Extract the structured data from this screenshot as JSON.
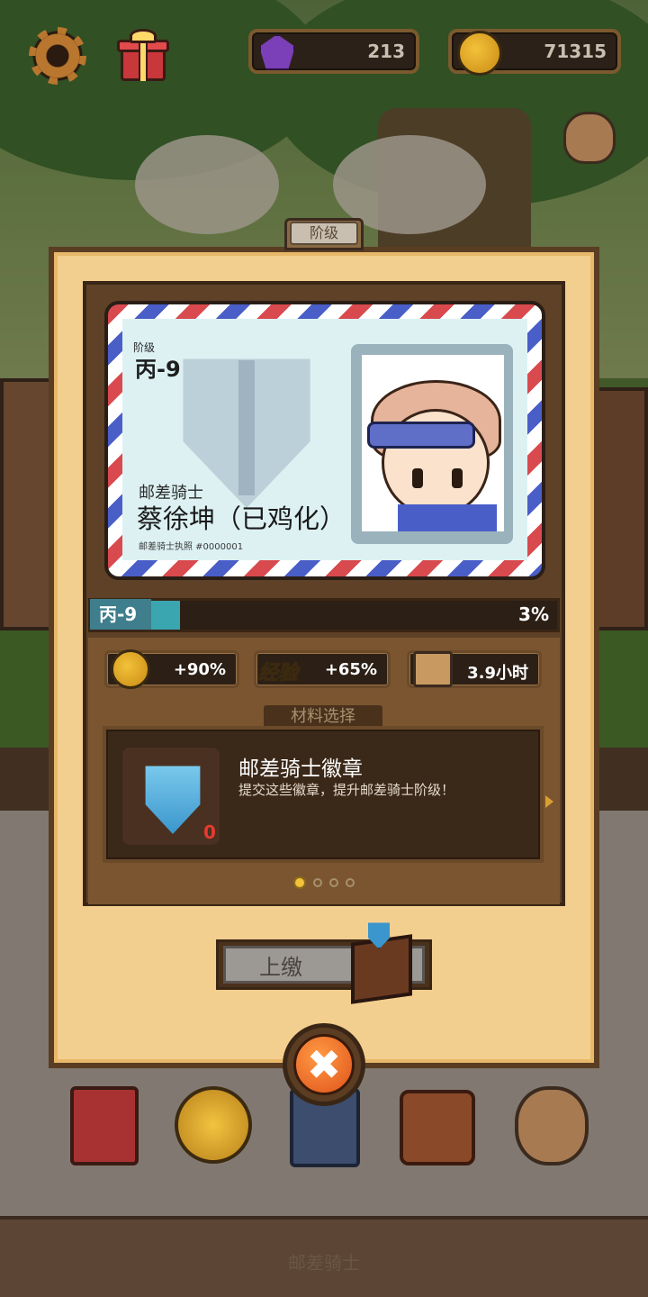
{
  "hud": {
    "gems": "213",
    "gold": "71315",
    "icons": [
      "gear-icon",
      "gift-icon",
      "gem-icon",
      "gold-coin-icon",
      "gem-bag-icon"
    ]
  },
  "panel": {
    "tab_label": "阶级"
  },
  "license_card": {
    "rank_label": "阶级",
    "rank_value": "丙-9",
    "title": "邮差骑士",
    "name": "蔡徐坤（已鸡化）",
    "license_no": "邮差骑士执照 #0000001"
  },
  "progress": {
    "label": "丙-9",
    "percent_text": "3%",
    "fraction": 0.03
  },
  "stats": {
    "gold_bonus": "+90%",
    "exp_label": "经验",
    "exp_bonus": "+65%",
    "time": "3.9小时"
  },
  "materials": {
    "tab_label": "材料选择",
    "item_name": "邮差骑士徽章",
    "item_desc": "提交这些徽章，提升邮差骑士阶级！",
    "count": "0",
    "page_count": 4,
    "active_page": 0
  },
  "actions": {
    "submit_label": "上缴"
  },
  "bottom_nav": {
    "title": "邮差骑士",
    "items": [
      "book-icon",
      "medal-icon",
      "cards-icon",
      "satchel-icon",
      "money-bag-icon"
    ]
  },
  "colors": {
    "panel": "#f3cf8f",
    "frame": "#5e4126",
    "progress_fill": "#3aa6b0",
    "accent_gold": "#f3c23a",
    "count_red": "#e53a30"
  }
}
